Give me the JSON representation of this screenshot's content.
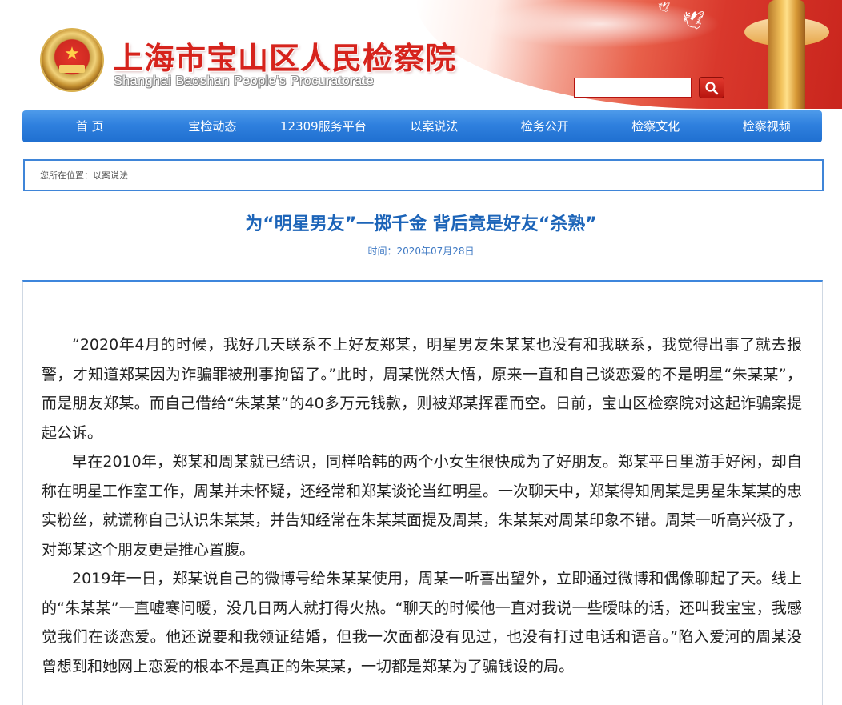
{
  "header": {
    "title": "上海市宝山区人民检察院",
    "subtitle": "Shanghai Baoshan People's Procuratorate",
    "search_placeholder": "",
    "search_icon": "search-icon",
    "emblem_icon": "procuratorate-emblem-icon"
  },
  "nav": {
    "items": [
      {
        "label": "首 页"
      },
      {
        "label": "宝检动态"
      },
      {
        "label": "12309服务平台"
      },
      {
        "label": "以案说法"
      },
      {
        "label": "检务公开"
      },
      {
        "label": "检察文化"
      },
      {
        "label": "检察视频"
      }
    ]
  },
  "breadcrumb": {
    "prefix": "您所在位置：",
    "current": "以案说法"
  },
  "article": {
    "title": "为“明星男友”一掷千金 背后竟是好友“杀熟”",
    "date": "时间：2020年07月28日",
    "paragraphs": [
      "“2020年4月的时候，我好几天联系不上好友郑某，明星男友朱某某也没有和我联系，我觉得出事了就去报警，才知道郑某因为诈骗罪被刑事拘留了。”此时，周某恍然大悟，原来一直和自己谈恋爱的不是明星“朱某某”，而是朋友郑某。而自己借给“朱某某”的40多万元钱款，则被郑某挥霍而空。日前，宝山区检察院对这起诈骗案提起公诉。",
      "早在2010年，郑某和周某就已结识，同样哈韩的两个小女生很快成为了好朋友。郑某平日里游手好闲，却自称在明星工作室工作，周某并未怀疑，还经常和郑某谈论当红明星。一次聊天中，郑某得知周某是男星朱某某的忠实粉丝，就谎称自己认识朱某某，并告知经常在朱某某面提及周某，朱某某对周某印象不错。周某一听高兴极了，对郑某这个朋友更是推心置腹。",
      "2019年一日，郑某说自己的微博号给朱某某使用，周某一听喜出望外，立即通过微博和偶像聊起了天。线上的“朱某某”一直嘘寒问暖，没几日两人就打得火热。“聊天的时候他一直对我说一些暧昧的话，还叫我宝宝，我感觉我们在谈恋爱。他还说要和我领证结婚，但我一次面都没有见过，也没有打过电话和语音。”陷入爱河的周某没曾想到和她网上恋爱的根本不是真正的朱某某，一切都是郑某为了骗钱设的局。"
    ]
  },
  "colors": {
    "title_red": "#d6231c",
    "nav_blue": "#2f80de",
    "article_title_blue": "#1c64b8",
    "border_blue": "#3d86dc"
  }
}
